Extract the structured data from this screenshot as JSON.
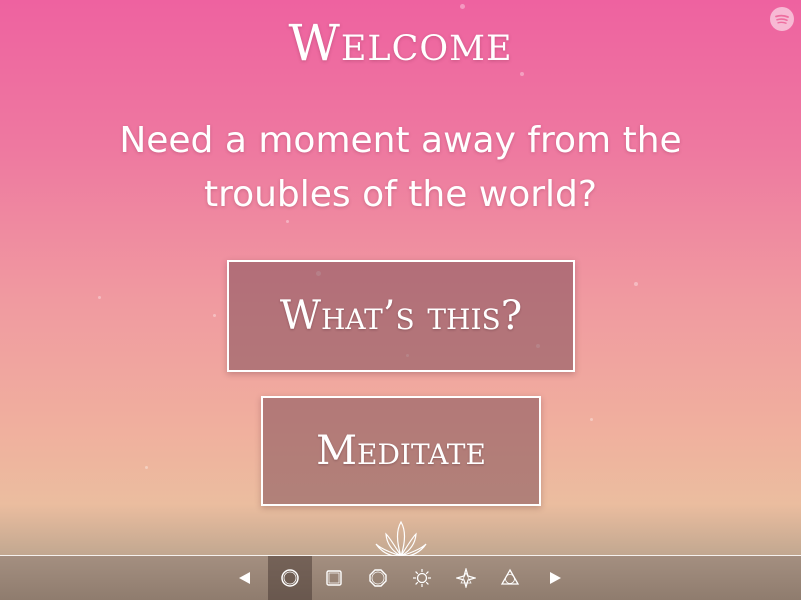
{
  "header": {
    "title": "Welcome"
  },
  "main": {
    "tagline": "Need a moment away from the troubles of the world?",
    "buttons": {
      "whats_this": "What’s this?",
      "meditate": "Meditate"
    }
  },
  "footer": {
    "nav_items": [
      "prev-arrow-icon",
      "circle-icon",
      "square-icon",
      "octagon-icon",
      "sunburst-icon",
      "star-icon",
      "triangle-icon",
      "next-arrow-icon"
    ],
    "active_index": 1
  },
  "colors": {
    "button_fill": "#9f6b72",
    "bar": "#9a8577"
  }
}
